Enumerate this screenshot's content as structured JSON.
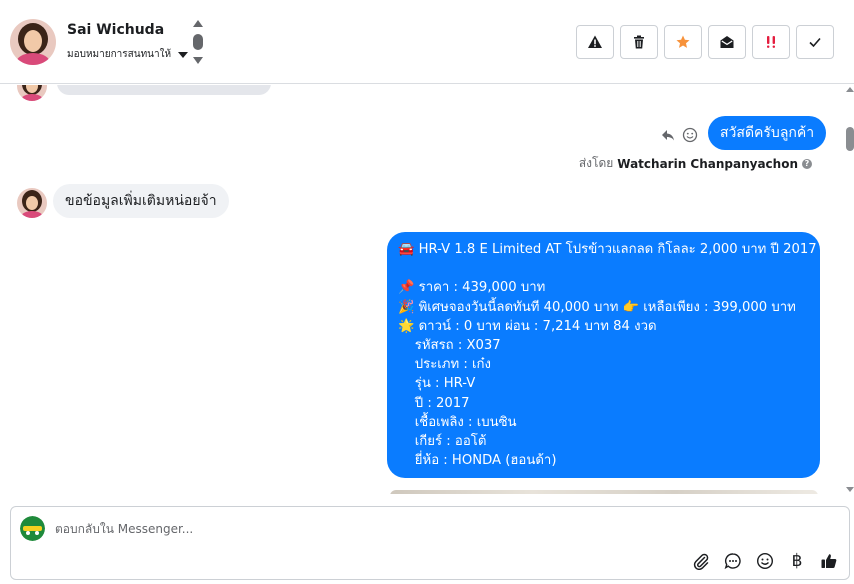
{
  "header": {
    "contact_name": "Sai Wichuda",
    "assign_label": "มอบหมายการสนทนาให้"
  },
  "toolbar": {
    "buttons": [
      {
        "name": "spam",
        "icon": "warning-icon"
      },
      {
        "name": "delete",
        "icon": "trash-icon"
      },
      {
        "name": "star",
        "icon": "star-icon",
        "color": "#f7923a"
      },
      {
        "name": "mark-unread",
        "icon": "envelope-open-icon"
      },
      {
        "name": "follow-up",
        "icon": "double-exclamation-icon",
        "color": "#e41e3f"
      },
      {
        "name": "done",
        "icon": "check-icon"
      }
    ]
  },
  "conversation": {
    "messages": [
      {
        "from": "customer",
        "text": "สวัสดีครับลูกค้า",
        "outgoing": true
      },
      {
        "sent_by_prefix": "ส่งโดย",
        "sent_by_name": "Watcharin Chanpanyachon"
      },
      {
        "from": "customer",
        "text": "ขอข้อมูลเพิ่มเติมหน่อยจ้า"
      }
    ],
    "outgoing_greeting": "สวัสดีครับลูกค้า",
    "sent_by_prefix": "ส่งโดย",
    "sent_by_name": "Watcharin Chanpanyachon",
    "incoming_request": "ขอข้อมูลเพิ่มเติมหน่อยจ้า",
    "listing_card": {
      "lines": [
        "🚘 HR-V 1.8 E Limited AT โปรข้าวแลกลด กิโลละ 2,000 บาท ปี 2017",
        " ",
        "📌 ราคา : 439,000 บาท",
        "🎉 พิเศษจองวันนี้ลดทันที 40,000 บาท 👉 เหลือเพียง : 399,000 บาท",
        "🌟 ดาวน์ : 0 บาท ผ่อน : 7,214 บาท 84 งวด",
        "    รหัสรถ : X037",
        "    ประเภท : เก๋ง",
        "    รุ่น : HR-V",
        "    ปี : 2017",
        "    เชื้อเพลิง : เบนซิน",
        "    เกียร์ : ออโต้",
        "    ยี่ห้อ : HONDA (ฮอนด้า)"
      ]
    }
  },
  "composer": {
    "placeholder": "ตอบกลับใน Messenger...",
    "tools": [
      "paperclip-icon",
      "saved-reply-icon",
      "emoji-icon",
      "baht-icon",
      "thumbs-up-icon"
    ],
    "baht_symbol": "฿"
  },
  "colors": {
    "outgoing_bubble": "#0a7cff",
    "incoming_bubble": "#f0f2f5",
    "star": "#f7923a",
    "follow_up": "#e41e3f"
  }
}
